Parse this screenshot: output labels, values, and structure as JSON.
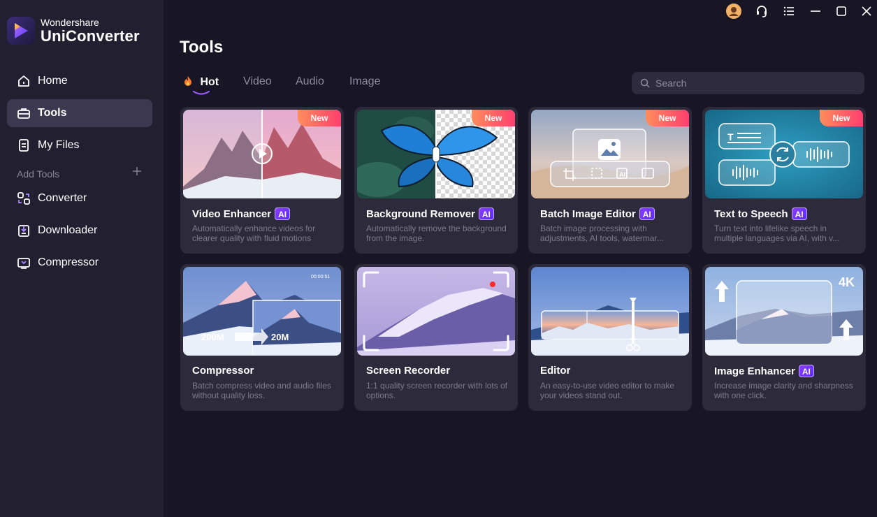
{
  "app": {
    "brand": "Wondershare",
    "product": "UniConverter"
  },
  "sidebar": {
    "items": [
      {
        "label": "Home",
        "icon": "home-icon"
      },
      {
        "label": "Tools",
        "icon": "toolbox-icon",
        "active": true
      },
      {
        "label": "My Files",
        "icon": "files-icon"
      }
    ],
    "add_tools_label": "Add Tools",
    "tools": [
      {
        "label": "Converter",
        "icon": "converter-icon"
      },
      {
        "label": "Downloader",
        "icon": "downloader-icon"
      },
      {
        "label": "Compressor",
        "icon": "compressor-icon"
      }
    ]
  },
  "header": {
    "title": "Tools"
  },
  "tabs": [
    {
      "label": "Hot",
      "active": true
    },
    {
      "label": "Video"
    },
    {
      "label": "Audio"
    },
    {
      "label": "Image"
    }
  ],
  "search": {
    "placeholder": "Search"
  },
  "cards": [
    {
      "title": "Video Enhancer",
      "ai": "AI",
      "new": "New",
      "desc": "Automatically enhance videos for clearer quality with fluid motions"
    },
    {
      "title": "Background Remover",
      "ai": "AI",
      "new": "New",
      "desc": "Automatically remove the background from the image."
    },
    {
      "title": "Batch Image Editor",
      "ai": "AI",
      "new": "New",
      "desc": "Batch image processing with adjustments, AI tools, watermar..."
    },
    {
      "title": "Text to Speech",
      "ai": "AI",
      "new": "New",
      "desc": "Turn text into lifelike speech in multiple languages via AI, with v..."
    },
    {
      "title": "Compressor",
      "desc": "Batch compress video and audio files without quality loss.",
      "thumb_text": {
        "from": "200M",
        "to": "20M",
        "time": "00:00:51"
      }
    },
    {
      "title": "Screen Recorder",
      "desc": "1:1 quality screen recorder with lots of options."
    },
    {
      "title": "Editor",
      "desc": "An easy-to-use video editor to make your videos stand out."
    },
    {
      "title": "Image Enhancer",
      "ai": "AI",
      "desc": "Increase image clarity and sharpness with one click.",
      "thumb_text": {
        "res": "4K"
      }
    }
  ],
  "colors": {
    "background": "#181624",
    "sidebar": "#221f31",
    "card": "#2c2a3b",
    "accent": "#8a3dff",
    "new_badge": "#ff3f6e"
  }
}
